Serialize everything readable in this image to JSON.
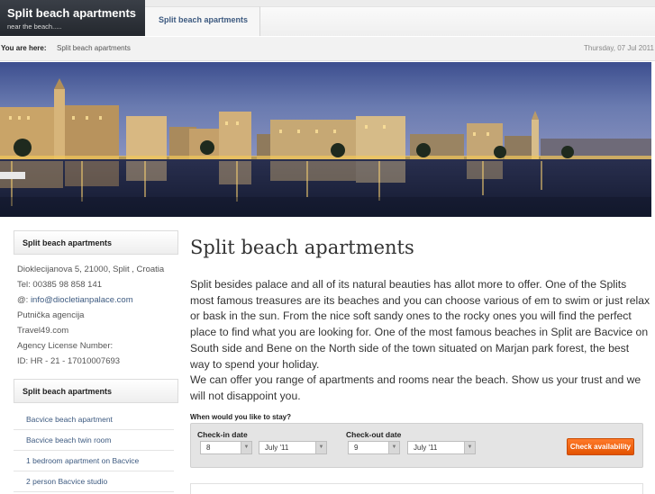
{
  "header": {
    "site_title": "Split beach apartments",
    "site_subtitle": "near the beach.....",
    "tab_label": "Split beach apartments"
  },
  "breadcrumb": {
    "label": "You are here:",
    "current": "Split beach apartments",
    "date": "Thursday, 07 Jul 2011"
  },
  "sidebar": {
    "contact_heading": "Split beach apartments",
    "contact_lines": [
      "Dioklecijanova 5, 21000, Split , Croatia",
      "Tel: 00385 98 858 141",
      "@: ",
      "info@diocletianpalace.com",
      "Putnička agencija",
      "Travel49.com",
      "Agency License Number:",
      "ID: HR - 21 - 17010007693"
    ],
    "apartments_heading": "Split beach apartments",
    "apartments_links": [
      "Bacvice beach apartment",
      "Bacvice beach twin room",
      "1 bedroom apartment on Bacvice",
      "2 person Bacvice studio"
    ]
  },
  "main": {
    "title": "Split beach apartments",
    "paragraph1": "Split besides palace and all of its natural beauties has allot more to offer. One of the Splits most famous treasures are its beaches and you can choose various of em to swim or just relax or bask in the sun. From the nice soft sandy ones to the rocky ones you will find the perfect place to find what you are looking for. One of the most famous beaches in Split are Bacvice on South side and Bene on the North side of the town situated on Marjan park forest, the best way to spend your holiday.",
    "paragraph2": "We can offer you range of apartments and rooms near the beach. Show us your trust and we will not disappoint you."
  },
  "booking": {
    "question": "When would you like to stay?",
    "checkin_label": "Check-in date",
    "checkin_day": "8",
    "checkin_month": "July '11",
    "checkout_label": "Check-out date",
    "checkout_day": "9",
    "checkout_month": "July '11",
    "button_label": "Check availability",
    "button_color": "#f26b1d"
  },
  "icons": {
    "dropdown_arrow": "chevron-down-icon"
  }
}
